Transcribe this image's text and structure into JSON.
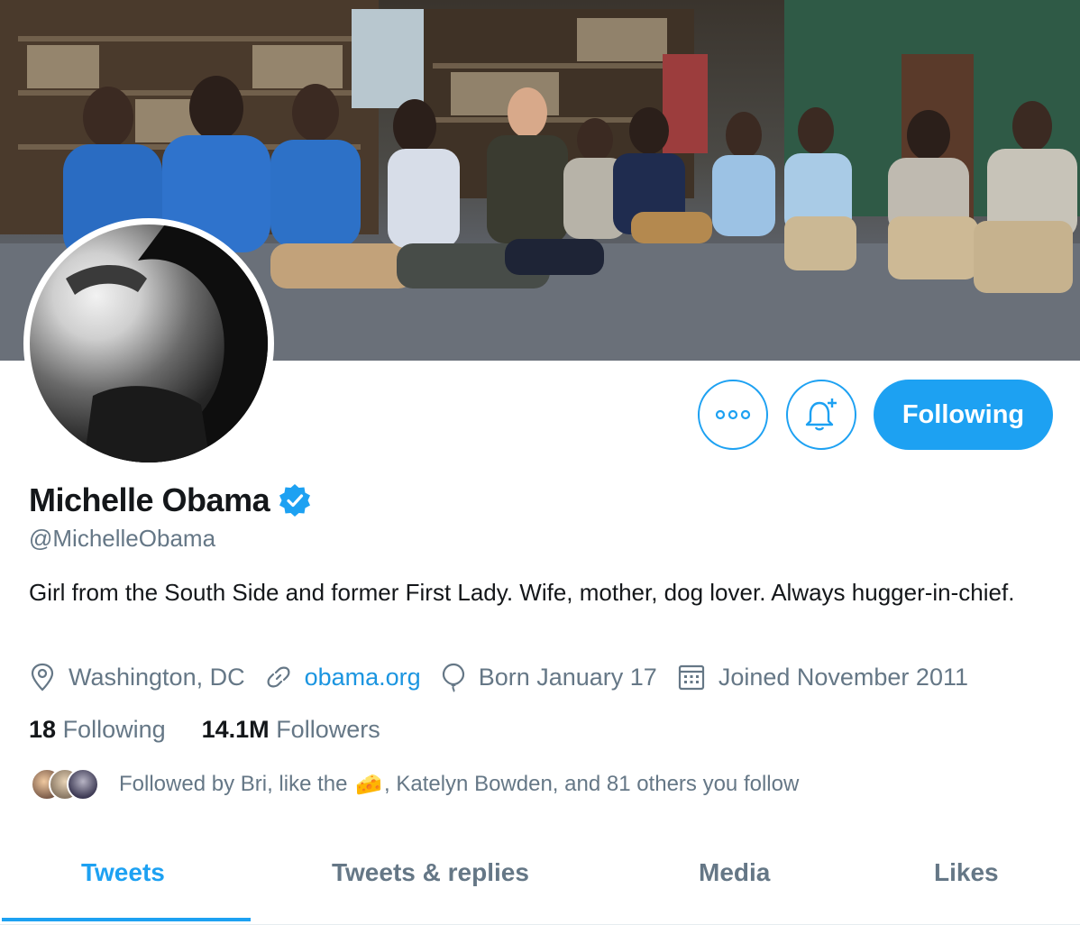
{
  "profile": {
    "name": "Michelle Obama",
    "handle": "@MichelleObama",
    "bio": "Girl from the South Side and former First Lady. Wife, mother, dog lover. Always hugger-in-chief.",
    "verified": true
  },
  "meta": {
    "location": "Washington, DC",
    "website": "obama.org",
    "birthday": "Born January 17",
    "joined": "Joined November 2011"
  },
  "stats": {
    "following_count": "18",
    "following_label": "Following",
    "followers_count": "14.1M",
    "followers_label": "Followers"
  },
  "followed_by": {
    "prefix": "Followed by Bri, like the",
    "emoji": "🧀",
    "suffix": ", Katelyn Bowden, and 81 others you follow"
  },
  "actions": {
    "following_button": "Following"
  },
  "tabs": [
    {
      "label": "Tweets",
      "active": true
    },
    {
      "label": "Tweets & replies",
      "active": false
    },
    {
      "label": "Media",
      "active": false
    },
    {
      "label": "Likes",
      "active": false
    }
  ],
  "icons": {
    "more": "more-icon",
    "notify": "bell-plus-icon",
    "location": "location-pin-icon",
    "link": "link-icon",
    "birthday": "balloon-icon",
    "calendar": "calendar-icon",
    "verified": "verified-badge-icon"
  },
  "colors": {
    "accent": "#1da1f2",
    "link": "#1b95e0",
    "secondary_text": "#657786",
    "primary_text": "#14171a"
  }
}
